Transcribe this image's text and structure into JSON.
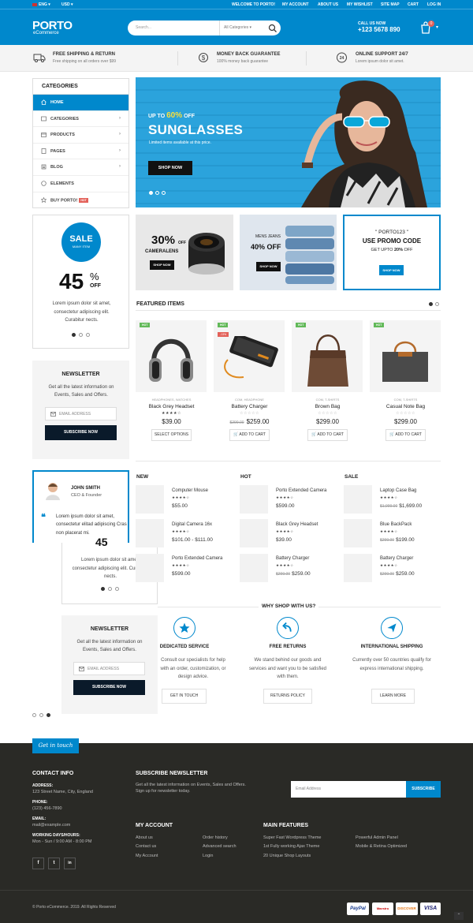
{
  "topbar": {
    "lang": "ENG",
    "currency": "USD",
    "links": [
      "WELCOME TO PORTO!",
      "MY ACCOUNT",
      "ABOUT US",
      "MY WISHLIST",
      "SITE MAP",
      "CART",
      "LOG IN"
    ],
    "logo": "PORTO",
    "logo_sub": "eCommerce",
    "search_placeholder": "Search...",
    "search_category": "All Categories",
    "call_label": "CALL US NOW",
    "phone": "+123 5678 890",
    "cart_count": "0"
  },
  "infobar": [
    {
      "title": "FREE SHIPPING & RETURN",
      "sub": "Free shipping on all orders over $99",
      "icon": "truck-icon"
    },
    {
      "title": "MONEY BACK GUARANTEE",
      "sub": "100% money back guarantee",
      "icon": "dollar-icon"
    },
    {
      "title": "ONLINE SUPPORT 24/7",
      "sub": "Lorem ipsum dolor sit amet.",
      "icon": "support-24-icon"
    }
  ],
  "sidebar": {
    "title": "CATEGORIES",
    "items": [
      {
        "label": "HOME",
        "icon": "home-icon"
      },
      {
        "label": "CATEGORIES",
        "icon": "grid-icon"
      },
      {
        "label": "PRODUCTS",
        "icon": "box-icon"
      },
      {
        "label": "PAGES",
        "icon": "page-icon"
      },
      {
        "label": "BLOG",
        "icon": "blog-icon"
      },
      {
        "label": "ELEMENTS",
        "icon": "elements-icon"
      },
      {
        "label": "BUY PORTO!",
        "icon": "star-icon",
        "badge": "HOT"
      }
    ]
  },
  "banner": {
    "pre": "UP TO",
    "percent": "60%",
    "off": "OFF",
    "title": "SUNGLASSES",
    "sub": "Limited items available at this price.",
    "button": "SHOP NOW"
  },
  "promos": [
    {
      "big": "30%",
      "off": "OFF",
      "name": "CAMERALENS",
      "button": "SHOP NOW"
    },
    {
      "top": "MENS JEANS",
      "big": "40% OFF",
      "button": "SHOP NOW"
    },
    {
      "code": "PORTO123",
      "line1": "USE PROMO CODE",
      "line2a": "GET UPTO ",
      "line2b": "20%",
      "line2c": " OFF",
      "button": "SHOP NOW"
    }
  ],
  "sale_widget": {
    "badge_top": "SALE",
    "badge_sub": "MANY ITEM",
    "percent": "45",
    "pct_sign": "%",
    "off": "OFF",
    "text": "Lorem ipsum dolor sit amet, consectetur adipiscing elit. Curabitur nects."
  },
  "newsletter": {
    "title": "NEWSLETTER",
    "text": "Get all the latest information on Events, Sales and Offers.",
    "placeholder": "EMAIL ADDRESS",
    "button": "SUBSCRIBE NOW"
  },
  "testimonial": {
    "name": "JOHN SMITH",
    "role": "CEO & Founder",
    "quote": "Lorem ipsum dolor sit amet, consectetur elitad adipiscing Cras non placerat mi."
  },
  "sale_widget_2": {
    "percent": "45",
    "text": "Lorem ipsum dolor sit amet, consectetur adipiscing elit. Curabitur nects."
  },
  "newsletter_2": {
    "title": "NEWSLETTER",
    "text": "Get all the latest information on Events, Sales and Offers.",
    "placeholder": "EMAIL ADDRESS",
    "button": "SUBSCRIBE NOW"
  },
  "featured": {
    "title": "FEATURED ITEMS",
    "items": [
      {
        "hot": "HOT",
        "cat": "HEADPHONES, WATCHES",
        "name": "Black Grey Headset",
        "stars": "★★★★☆",
        "price": "$39.00",
        "old": "",
        "button": "SELECT OPTIONS"
      },
      {
        "hot": "HOT",
        "sale": "-13%",
        "cat": "COM, HEADPHONE",
        "name": "Battery Charger",
        "stars": "☆☆☆☆☆",
        "price": "$259.00",
        "old": "$299.00",
        "button": "ADD TO CART"
      },
      {
        "hot": "HOT",
        "cat": "COM, T-SHIRTS",
        "name": "Brown Bag",
        "stars": "☆☆☆☆☆",
        "price": "$299.00",
        "old": "",
        "button": "ADD TO CART"
      },
      {
        "hot": "HOT",
        "cat": "COM, T-SHIRTS",
        "name": "Casual Note Bag",
        "stars": "☆☆☆☆☆",
        "price": "$299.00",
        "old": "",
        "button": "ADD TO CART"
      }
    ]
  },
  "lists": [
    {
      "title": "NEW",
      "items": [
        {
          "name": "Computer Mouse",
          "stars": "★★★★☆",
          "price": "$55.00",
          "old": ""
        },
        {
          "name": "Digital Camera 16x",
          "stars": "★★★★☆",
          "price": "$101.00 - $111.00",
          "old": ""
        },
        {
          "name": "Porto Extended Camera",
          "stars": "★★★★☆",
          "price": "$599.00",
          "old": ""
        }
      ]
    },
    {
      "title": "HOT",
      "items": [
        {
          "name": "Porto Extended Camera",
          "stars": "★★★★☆",
          "price": "$599.00",
          "old": ""
        },
        {
          "name": "Black Grey Headset",
          "stars": "★★★★☆",
          "price": "$39.00",
          "old": ""
        },
        {
          "name": "Battery Charger",
          "stars": "★★★★☆",
          "price": "$259.00",
          "old": "$299.00"
        }
      ]
    },
    {
      "title": "SALE",
      "items": [
        {
          "name": "Laptop Case Bag",
          "stars": "★★★★☆",
          "price": "$1,699.00",
          "old": "$1,999.00"
        },
        {
          "name": "Blue BackPack",
          "stars": "★★★★☆",
          "price": "$199.00",
          "old": "$299.00"
        },
        {
          "name": "Battery Charger",
          "stars": "★★★★☆",
          "price": "$259.00",
          "old": "$299.00"
        }
      ]
    }
  ],
  "why": {
    "title": "WHY SHOP WITH US?",
    "items": [
      {
        "title": "DEDICATED SERVICE",
        "text": "Consult our specialists for help with an order, customization, or design advice.",
        "button": "GET IN TOUCH",
        "icon": "star-icon"
      },
      {
        "title": "FREE RETURNS",
        "text": "We stand behind our goods and services and want you to be satisfied with them.",
        "button": "RETURNS POLICY",
        "icon": "return-icon"
      },
      {
        "title": "INTERNATIONAL SHIPPING",
        "text": "Currently over 50 countries qualify for express international shipping.",
        "button": "LEARN MORE",
        "icon": "plane-icon"
      }
    ]
  },
  "footer": {
    "tab": "Get in touch",
    "contact_title": "CONTACT INFO",
    "address_label": "ADDRESS:",
    "address": "123 Street Name, City, England",
    "phone_label": "PHONE:",
    "phone": "(123) 456-7890",
    "email_label": "EMAIL:",
    "email": "mail@example.com",
    "hours_label": "WORKING DAYS/HOURS:",
    "hours": "Mon - Sun / 9:00 AM - 8:00 PM",
    "subscribe_title": "SUBSCRIBE NEWSLETTER",
    "subscribe_text1": "Get all the latest information on Events, Sales and Offers.",
    "subscribe_text2": "Sign up for newsletter today.",
    "email_placeholder": "Email Address",
    "subscribe_button": "SUBSCRIBE",
    "account_title": "MY ACCOUNT",
    "account_links": [
      "About us",
      "Contact us",
      "My Account",
      "Order history",
      "Advanced search",
      "Login"
    ],
    "features_title": "MAIN FEATURES",
    "features_links": [
      "Super Fast Wordpress Theme",
      "1st Fully working Ajax Theme",
      "20 Unique Shop Layouts",
      "Powerful Admin Panel",
      "Mobile & Retina Optimized"
    ],
    "social": [
      "f",
      "t",
      "in"
    ],
    "copyright": "© Porto eCommerce. 2019. All Rights Reserved",
    "payments": [
      "PayPal",
      "Maestro",
      "DISCOVER",
      "VISA"
    ]
  }
}
